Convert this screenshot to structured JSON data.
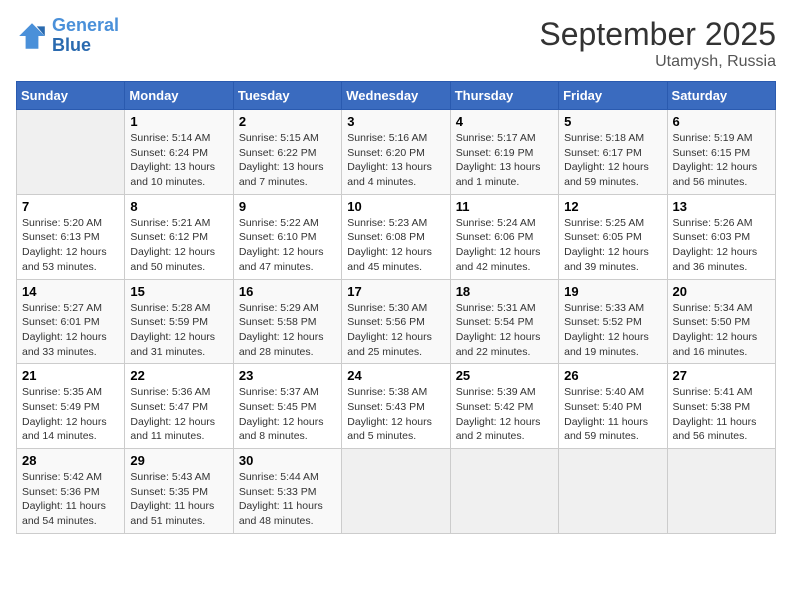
{
  "logo": {
    "line1": "General",
    "line2": "Blue"
  },
  "header": {
    "month": "September 2025",
    "location": "Utamysh, Russia"
  },
  "days_of_week": [
    "Sunday",
    "Monday",
    "Tuesday",
    "Wednesday",
    "Thursday",
    "Friday",
    "Saturday"
  ],
  "weeks": [
    [
      {
        "day": null
      },
      {
        "day": "1",
        "sunrise": "5:14 AM",
        "sunset": "6:24 PM",
        "daylight": "13 hours and 10 minutes."
      },
      {
        "day": "2",
        "sunrise": "5:15 AM",
        "sunset": "6:22 PM",
        "daylight": "13 hours and 7 minutes."
      },
      {
        "day": "3",
        "sunrise": "5:16 AM",
        "sunset": "6:20 PM",
        "daylight": "13 hours and 4 minutes."
      },
      {
        "day": "4",
        "sunrise": "5:17 AM",
        "sunset": "6:19 PM",
        "daylight": "13 hours and 1 minute."
      },
      {
        "day": "5",
        "sunrise": "5:18 AM",
        "sunset": "6:17 PM",
        "daylight": "12 hours and 59 minutes."
      },
      {
        "day": "6",
        "sunrise": "5:19 AM",
        "sunset": "6:15 PM",
        "daylight": "12 hours and 56 minutes."
      }
    ],
    [
      {
        "day": "7",
        "sunrise": "5:20 AM",
        "sunset": "6:13 PM",
        "daylight": "12 hours and 53 minutes."
      },
      {
        "day": "8",
        "sunrise": "5:21 AM",
        "sunset": "6:12 PM",
        "daylight": "12 hours and 50 minutes."
      },
      {
        "day": "9",
        "sunrise": "5:22 AM",
        "sunset": "6:10 PM",
        "daylight": "12 hours and 47 minutes."
      },
      {
        "day": "10",
        "sunrise": "5:23 AM",
        "sunset": "6:08 PM",
        "daylight": "12 hours and 45 minutes."
      },
      {
        "day": "11",
        "sunrise": "5:24 AM",
        "sunset": "6:06 PM",
        "daylight": "12 hours and 42 minutes."
      },
      {
        "day": "12",
        "sunrise": "5:25 AM",
        "sunset": "6:05 PM",
        "daylight": "12 hours and 39 minutes."
      },
      {
        "day": "13",
        "sunrise": "5:26 AM",
        "sunset": "6:03 PM",
        "daylight": "12 hours and 36 minutes."
      }
    ],
    [
      {
        "day": "14",
        "sunrise": "5:27 AM",
        "sunset": "6:01 PM",
        "daylight": "12 hours and 33 minutes."
      },
      {
        "day": "15",
        "sunrise": "5:28 AM",
        "sunset": "5:59 PM",
        "daylight": "12 hours and 31 minutes."
      },
      {
        "day": "16",
        "sunrise": "5:29 AM",
        "sunset": "5:58 PM",
        "daylight": "12 hours and 28 minutes."
      },
      {
        "day": "17",
        "sunrise": "5:30 AM",
        "sunset": "5:56 PM",
        "daylight": "12 hours and 25 minutes."
      },
      {
        "day": "18",
        "sunrise": "5:31 AM",
        "sunset": "5:54 PM",
        "daylight": "12 hours and 22 minutes."
      },
      {
        "day": "19",
        "sunrise": "5:33 AM",
        "sunset": "5:52 PM",
        "daylight": "12 hours and 19 minutes."
      },
      {
        "day": "20",
        "sunrise": "5:34 AM",
        "sunset": "5:50 PM",
        "daylight": "12 hours and 16 minutes."
      }
    ],
    [
      {
        "day": "21",
        "sunrise": "5:35 AM",
        "sunset": "5:49 PM",
        "daylight": "12 hours and 14 minutes."
      },
      {
        "day": "22",
        "sunrise": "5:36 AM",
        "sunset": "5:47 PM",
        "daylight": "12 hours and 11 minutes."
      },
      {
        "day": "23",
        "sunrise": "5:37 AM",
        "sunset": "5:45 PM",
        "daylight": "12 hours and 8 minutes."
      },
      {
        "day": "24",
        "sunrise": "5:38 AM",
        "sunset": "5:43 PM",
        "daylight": "12 hours and 5 minutes."
      },
      {
        "day": "25",
        "sunrise": "5:39 AM",
        "sunset": "5:42 PM",
        "daylight": "12 hours and 2 minutes."
      },
      {
        "day": "26",
        "sunrise": "5:40 AM",
        "sunset": "5:40 PM",
        "daylight": "11 hours and 59 minutes."
      },
      {
        "day": "27",
        "sunrise": "5:41 AM",
        "sunset": "5:38 PM",
        "daylight": "11 hours and 56 minutes."
      }
    ],
    [
      {
        "day": "28",
        "sunrise": "5:42 AM",
        "sunset": "5:36 PM",
        "daylight": "11 hours and 54 minutes."
      },
      {
        "day": "29",
        "sunrise": "5:43 AM",
        "sunset": "5:35 PM",
        "daylight": "11 hours and 51 minutes."
      },
      {
        "day": "30",
        "sunrise": "5:44 AM",
        "sunset": "5:33 PM",
        "daylight": "11 hours and 48 minutes."
      },
      {
        "day": null
      },
      {
        "day": null
      },
      {
        "day": null
      },
      {
        "day": null
      }
    ]
  ]
}
